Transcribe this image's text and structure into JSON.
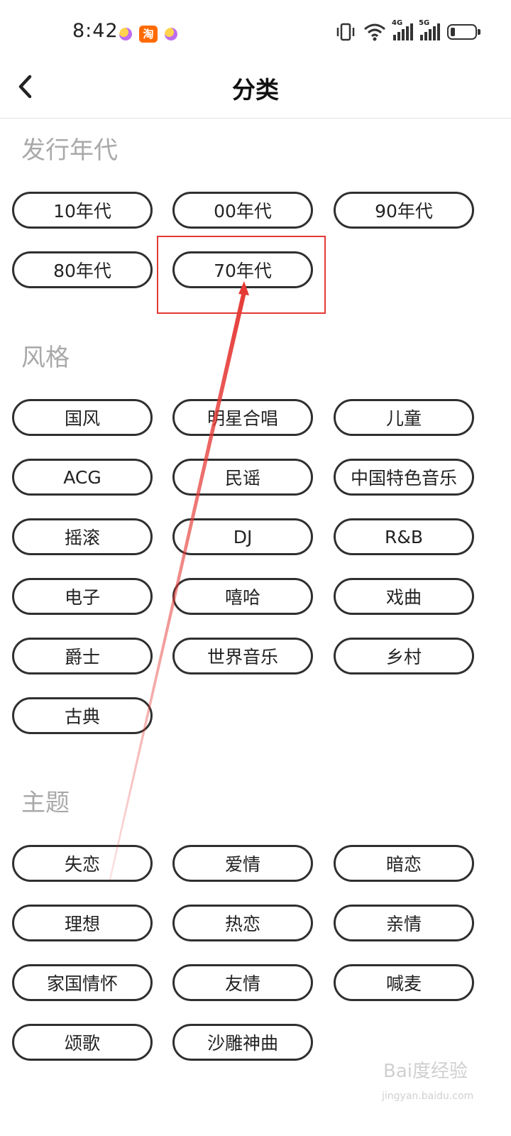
{
  "status_bar": {
    "time": "8:42",
    "taobao_label": "淘",
    "network_1": "4G",
    "network_2": "5G",
    "icons": [
      "notification-dot-icon",
      "taobao-app-icon",
      "notification-dot-icon",
      "vibrate-icon",
      "wifi-icon",
      "signal-4g-icon",
      "signal-5g-icon",
      "battery-icon"
    ],
    "battery_level": 0.2
  },
  "header": {
    "title": "分类",
    "back_icon": "chevron-left-icon"
  },
  "sections": [
    {
      "title": "发行年代",
      "items": [
        "10年代",
        "00年代",
        "90年代",
        "80年代",
        "70年代"
      ]
    },
    {
      "title": "风格",
      "items": [
        "国风",
        "明星合唱",
        "儿童",
        "ACG",
        "民谣",
        "中国特色音乐",
        "摇滚",
        "DJ",
        "R&B",
        "电子",
        "嘻哈",
        "戏曲",
        "爵士",
        "世界音乐",
        "乡村",
        "古典"
      ]
    },
    {
      "title": "主题",
      "items": [
        "失恋",
        "爱情",
        "暗恋",
        "理想",
        "热恋",
        "亲情",
        "家国情怀",
        "友情",
        "喊麦",
        "颂歌",
        "沙雕神曲"
      ]
    }
  ],
  "annotation": {
    "highlighted_item": "70年代",
    "color": "#e53935"
  },
  "watermark": {
    "text": "Bai度经验",
    "sub": "jingyan.baidu.com"
  }
}
